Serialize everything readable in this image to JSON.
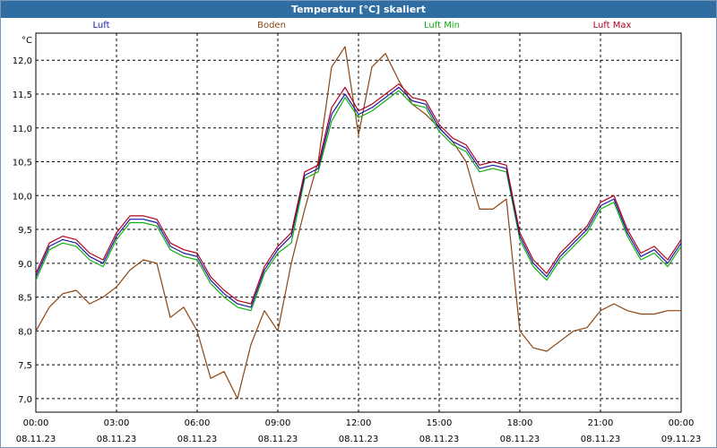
{
  "window": {
    "title": "Temperatur [°C] skaliert"
  },
  "legend": [
    {
      "name": "Luft",
      "color": "#1a1aa6"
    },
    {
      "name": "Boden",
      "color": "#8b4513"
    },
    {
      "name": "Luft Min",
      "color": "#10b010"
    },
    {
      "name": "Luft Max",
      "color": "#b00020"
    }
  ],
  "chart_data": {
    "type": "line",
    "title": "Temperatur [°C] skaliert",
    "ylabel": "°C",
    "xlabel": "",
    "ylim": [
      6.8,
      12.4
    ],
    "xlim": [
      0,
      24
    ],
    "grid": true,
    "legend_position": "top",
    "yticks": [
      7.0,
      7.5,
      8.0,
      8.5,
      9.0,
      9.5,
      10.0,
      10.5,
      11.0,
      11.5,
      12.0
    ],
    "ytick_labels": [
      "7,0",
      "7,5",
      "8,0",
      "8,5",
      "9,0",
      "9,5",
      "10,0",
      "10,5",
      "11,0",
      "11,5",
      "12,0"
    ],
    "xticks": [
      0,
      3,
      6,
      9,
      12,
      15,
      18,
      21,
      24
    ],
    "xtick_labels": [
      {
        "time": "00:00",
        "date": "08.11.23"
      },
      {
        "time": "03:00",
        "date": "08.11.23"
      },
      {
        "time": "06:00",
        "date": "08.11.23"
      },
      {
        "time": "09:00",
        "date": "08.11.23"
      },
      {
        "time": "12:00",
        "date": "08.11.23"
      },
      {
        "time": "15:00",
        "date": "08.11.23"
      },
      {
        "time": "18:00",
        "date": "08.11.23"
      },
      {
        "time": "21:00",
        "date": "08.11.23"
      },
      {
        "time": "00:00",
        "date": "09.11.23"
      }
    ],
    "x": [
      0,
      0.5,
      1,
      1.5,
      2,
      2.5,
      3,
      3.5,
      4,
      4.5,
      5,
      5.5,
      6,
      6.5,
      7,
      7.5,
      8,
      8.5,
      9,
      9.5,
      10,
      10.5,
      11,
      11.5,
      12,
      12.5,
      13,
      13.5,
      14,
      14.5,
      15,
      15.5,
      16,
      16.5,
      17,
      17.5,
      18,
      18.5,
      19,
      19.5,
      20,
      20.5,
      21,
      21.5,
      22,
      22.5,
      23,
      23.5,
      24
    ],
    "series": [
      {
        "name": "Luft",
        "color": "#1a1aa6",
        "values": [
          8.8,
          9.25,
          9.35,
          9.3,
          9.1,
          9.0,
          9.4,
          9.65,
          9.65,
          9.6,
          9.25,
          9.15,
          9.1,
          8.75,
          8.55,
          8.4,
          8.35,
          8.9,
          9.2,
          9.4,
          10.3,
          10.4,
          11.2,
          11.5,
          11.2,
          11.3,
          11.45,
          11.6,
          11.4,
          11.35,
          11.0,
          10.8,
          10.7,
          10.4,
          10.45,
          10.4,
          9.4,
          9.0,
          8.8,
          9.1,
          9.3,
          9.5,
          9.85,
          9.95,
          9.45,
          9.1,
          9.2,
          9.0,
          9.3
        ]
      },
      {
        "name": "Boden",
        "color": "#8b4513",
        "values": [
          8.0,
          8.35,
          8.55,
          8.6,
          8.4,
          8.5,
          8.65,
          8.9,
          9.05,
          9.0,
          8.2,
          8.35,
          8.0,
          7.3,
          7.4,
          7.0,
          7.8,
          8.3,
          8.0,
          9.0,
          9.8,
          10.5,
          11.9,
          12.2,
          10.9,
          11.9,
          12.1,
          11.7,
          11.35,
          11.2,
          11.0,
          10.8,
          10.5,
          9.8,
          9.8,
          9.95,
          8.0,
          7.75,
          7.7,
          7.85,
          8.0,
          8.05,
          8.3,
          8.4,
          8.3,
          8.25,
          8.25,
          8.3,
          8.3
        ]
      },
      {
        "name": "Luft Min",
        "color": "#10b010",
        "values": [
          8.75,
          9.2,
          9.3,
          9.25,
          9.05,
          8.95,
          9.35,
          9.6,
          9.6,
          9.55,
          9.2,
          9.1,
          9.05,
          8.7,
          8.5,
          8.35,
          8.3,
          8.85,
          9.15,
          9.3,
          10.25,
          10.35,
          11.1,
          11.45,
          11.15,
          11.25,
          11.4,
          11.55,
          11.35,
          11.3,
          10.95,
          10.75,
          10.65,
          10.35,
          10.4,
          10.35,
          9.35,
          8.95,
          8.75,
          9.05,
          9.25,
          9.45,
          9.8,
          9.9,
          9.4,
          9.05,
          9.15,
          8.95,
          9.25
        ]
      },
      {
        "name": "Luft Max",
        "color": "#b00020",
        "values": [
          8.85,
          9.3,
          9.4,
          9.35,
          9.15,
          9.05,
          9.45,
          9.7,
          9.7,
          9.65,
          9.3,
          9.2,
          9.15,
          8.8,
          8.6,
          8.45,
          8.4,
          8.95,
          9.25,
          9.45,
          10.35,
          10.45,
          11.3,
          11.6,
          11.25,
          11.35,
          11.5,
          11.65,
          11.45,
          11.4,
          11.05,
          10.85,
          10.75,
          10.45,
          10.5,
          10.45,
          9.45,
          9.05,
          8.85,
          9.15,
          9.35,
          9.55,
          9.9,
          10.0,
          9.5,
          9.15,
          9.25,
          9.05,
          9.35
        ]
      }
    ]
  }
}
